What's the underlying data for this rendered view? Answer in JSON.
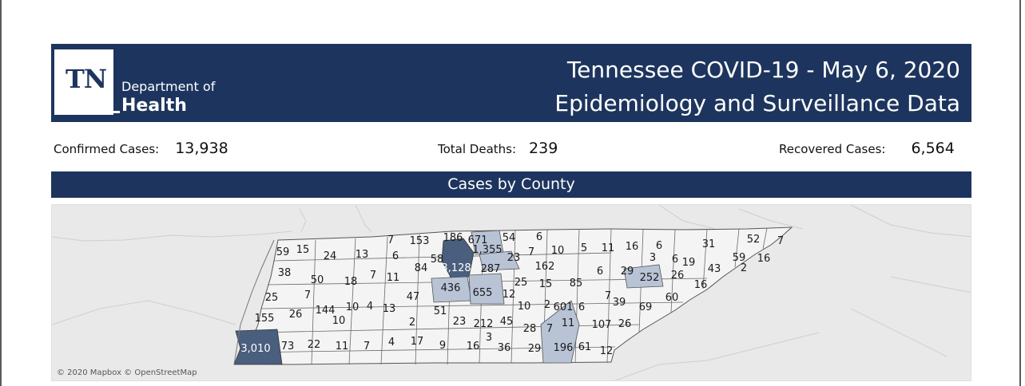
{
  "header": {
    "logo_tn": "TN",
    "logo_department": "Department of",
    "logo_health": "Health",
    "title_line1": "Tennessee COVID-19 - May 6, 2020",
    "title_line2": "Epidemiology and Surveillance Data"
  },
  "stats": {
    "confirmed_label": "Confirmed Cases:",
    "confirmed_value": "13,938",
    "deaths_label": "Total Deaths:",
    "deaths_value": "239",
    "recovered_label": "Recovered Cases:",
    "recovered_value": "6,564"
  },
  "section_title": "Cases by County",
  "map": {
    "attribution": "© 2020 Mapbox © OpenStreetMap",
    "colors": {
      "high": "#4a5e7e",
      "medium": "#b8c3d6",
      "low": "#f4f4f4",
      "background": "#e9e9e9",
      "header": "#1d355e"
    },
    "county_values": [
      "7",
      "153",
      "186",
      "671",
      "54",
      "6",
      "59",
      "15",
      "24",
      "13",
      "6",
      "58",
      "1,355",
      "7",
      "10",
      "5",
      "11",
      "16",
      "6",
      "31",
      "52",
      "7",
      "23",
      "3",
      "6",
      "59",
      "16",
      "38",
      "84",
      "3,128",
      "287",
      "162",
      "19",
      "43",
      "50",
      "18",
      "7",
      "11",
      "436",
      "25",
      "15",
      "85",
      "6",
      "29",
      "252",
      "26",
      "16",
      "2",
      "25",
      "7",
      "47",
      "655",
      "12",
      "7",
      "39",
      "60",
      "155",
      "26",
      "144",
      "10",
      "4",
      "13",
      "51",
      "10",
      "2",
      "601",
      "6",
      "69",
      "10",
      "2",
      "23",
      "212",
      "45",
      "28",
      "7",
      "11",
      "107",
      "26",
      "3,010",
      "73",
      "22",
      "11",
      "7",
      "4",
      "17",
      "9",
      "16",
      "3",
      "36",
      "29",
      "196",
      "61",
      "12"
    ]
  }
}
